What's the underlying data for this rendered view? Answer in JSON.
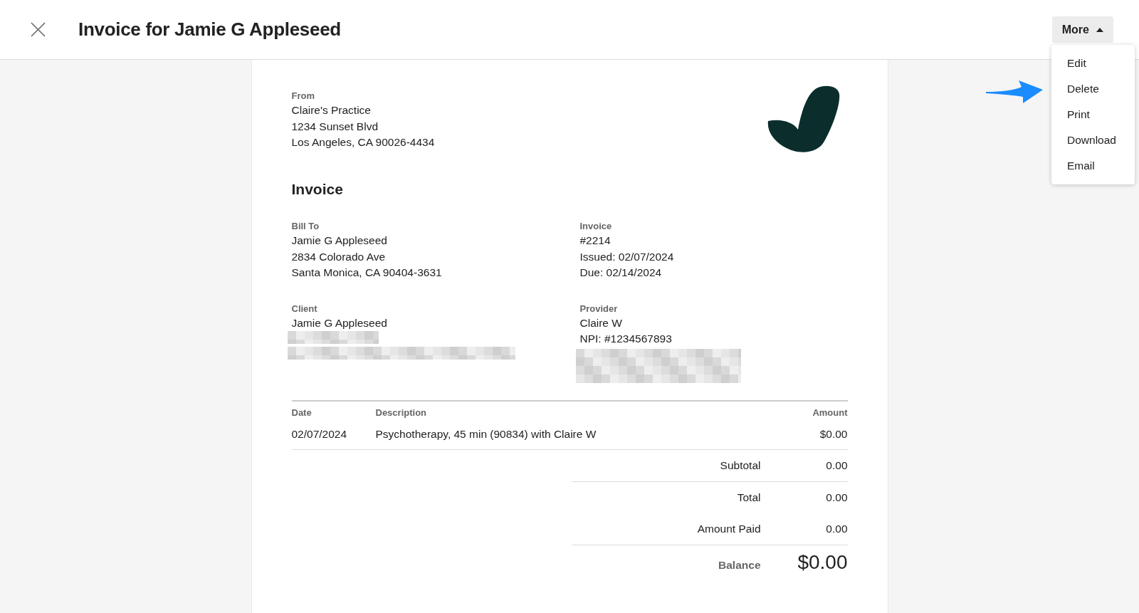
{
  "header": {
    "title": "Invoice for Jamie G Appleseed",
    "more_button": {
      "label": "More",
      "expanded": true
    }
  },
  "menu": {
    "items": [
      {
        "label": "Edit",
        "pointed_at": false
      },
      {
        "label": "Delete",
        "pointed_at": true
      },
      {
        "label": "Print",
        "pointed_at": false
      },
      {
        "label": "Download",
        "pointed_at": false
      },
      {
        "label": "Email",
        "pointed_at": false
      }
    ]
  },
  "invoice": {
    "from": {
      "label": "From",
      "lines": [
        "Claire's Practice",
        "1234 Sunset Blvd",
        "Los Angeles, CA 90026-4434"
      ]
    },
    "heading": "Invoice",
    "blocks": [
      {
        "label": "Bill To",
        "lines": [
          {
            "kind": "text",
            "text": "Jamie G Appleseed"
          },
          {
            "kind": "text",
            "text": "2834 Colorado Ave"
          },
          {
            "kind": "text",
            "text": "Santa Monica, CA 90404-3631"
          }
        ]
      },
      {
        "label": "Invoice",
        "lines": [
          {
            "kind": "text",
            "text": "#2214"
          },
          {
            "kind": "text",
            "text": "Issued: 02/07/2024"
          },
          {
            "kind": "text",
            "text": "Due: 02/14/2024"
          }
        ]
      },
      {
        "label": "Client",
        "lines": [
          {
            "kind": "text",
            "text": "Jamie G Appleseed"
          },
          {
            "kind": "short_redaction"
          },
          {
            "kind": "long_redaction"
          }
        ]
      },
      {
        "label": "Provider",
        "lines": [
          {
            "kind": "text",
            "text": "Claire W"
          },
          {
            "kind": "text",
            "text": "NPI: #1234567893"
          },
          {
            "kind": "block_redaction"
          }
        ]
      }
    ],
    "table": {
      "columns": [
        "Date",
        "Description",
        "Amount"
      ],
      "rows": [
        [
          "02/07/2024",
          "Psychotherapy, 45 min (90834) with Claire W",
          "$0.00"
        ]
      ]
    },
    "totals": [
      {
        "label": "Subtotal",
        "value": "0.00",
        "kind": "normal",
        "rule": true
      },
      {
        "label": "Total",
        "value": "0.00",
        "kind": "normal",
        "rule": false
      },
      {
        "label": "Amount Paid",
        "value": "0.00",
        "kind": "normal",
        "rule": true
      },
      {
        "label": "Balance",
        "value": "$0.00",
        "kind": "balance",
        "rule": false
      }
    ]
  }
}
